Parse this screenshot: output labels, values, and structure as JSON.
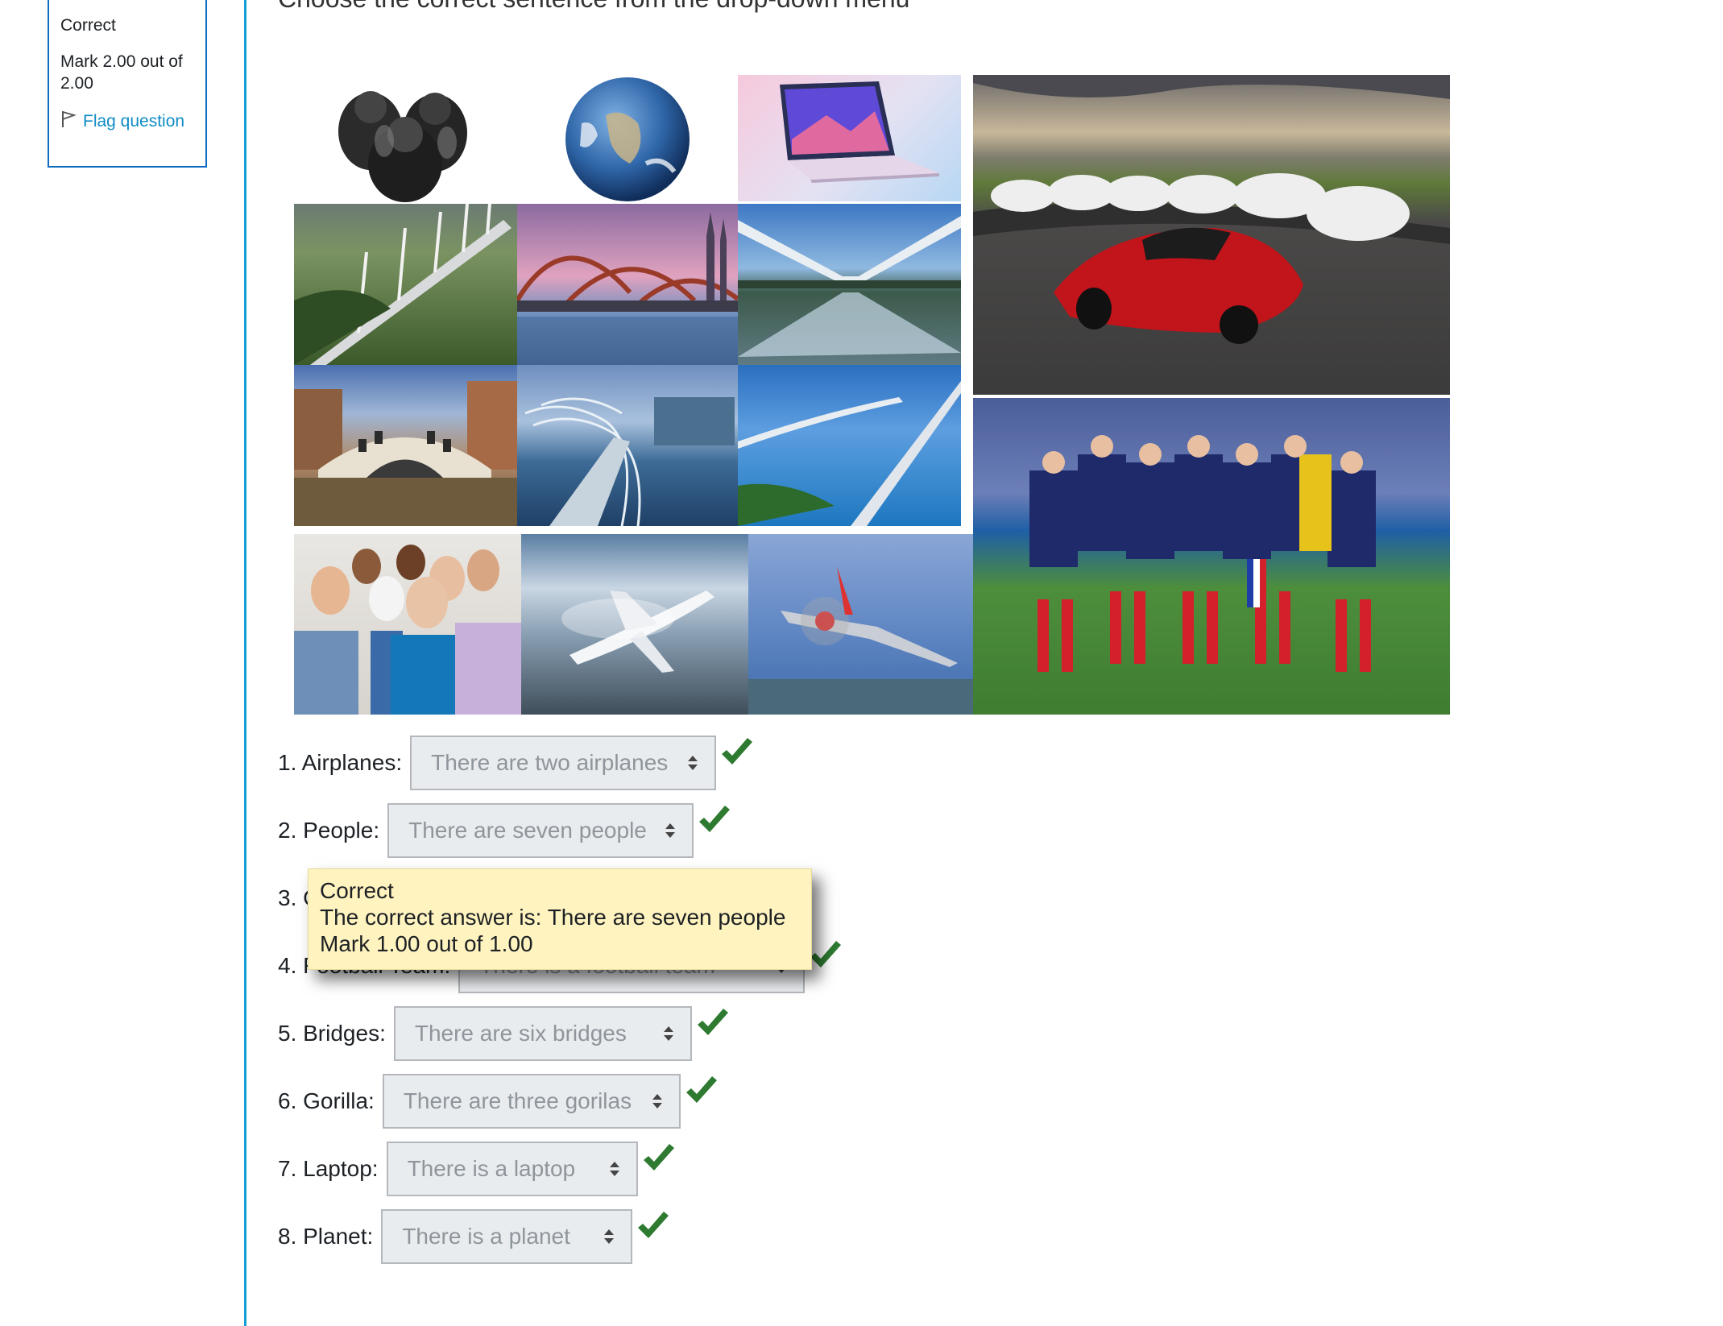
{
  "info": {
    "state": "Correct",
    "grade": "Mark 2.00 out of 2.00",
    "flag_label": "Flag question"
  },
  "question_text": "Choose the correct sentence from the drop-down menu",
  "rows": [
    {
      "label": "1. Airplanes:",
      "selected": "There are two airplanes"
    },
    {
      "label": "2. People:",
      "selected": "There are seven people"
    },
    {
      "label": "3. C",
      "selected": ""
    },
    {
      "label": "4. Football Team:",
      "selected": "There is a football team"
    },
    {
      "label": "5. Bridges:",
      "selected": "There are six bridges"
    },
    {
      "label": "6. Gorilla:",
      "selected": "There are three gorilas"
    },
    {
      "label": "7. Laptop:",
      "selected": "There is a laptop"
    },
    {
      "label": "8. Planet:",
      "selected": "There is a planet"
    }
  ],
  "tooltip": {
    "line1": "Correct",
    "line2": "The correct answer is: There are seven people",
    "line3": "Mark 1.00 out of 1.00"
  },
  "colors": {
    "accent": "#0f6cbf",
    "rule": "#14a0d6",
    "check": "#2d7a30",
    "tooltip_bg": "#fff3bf"
  },
  "images": [
    "gorillas",
    "earth",
    "laptop",
    "cars",
    "bridge-millau",
    "bridge-cologne",
    "bridge-glass",
    "bridge-rialto",
    "bridge-helix",
    "bridge-keys",
    "people",
    "airplane-jet",
    "airplane-prop",
    "football-team"
  ]
}
